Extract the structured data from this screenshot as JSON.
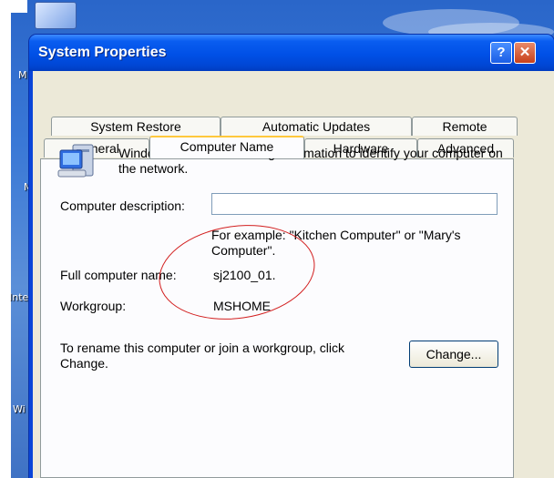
{
  "desktop": {
    "labels": [
      "M",
      "M",
      "Inte",
      "Wi"
    ]
  },
  "window": {
    "title": "System Properties",
    "help_btn": "?",
    "close_btn": "✕"
  },
  "tabs": {
    "row1": [
      "System Restore",
      "Automatic Updates",
      "Remote"
    ],
    "row2": [
      "General",
      "Computer Name",
      "Hardware",
      "Advanced"
    ],
    "active": "Computer Name"
  },
  "computer_name_tab": {
    "intro": "Windows uses the following information to identify your computer on the network.",
    "description_label": "Computer description:",
    "description_value": "",
    "example_text": "For example: \"Kitchen Computer\" or \"Mary's Computer\".",
    "full_name_label": "Full computer name:",
    "full_name_value": "sj2100_01.",
    "workgroup_label": "Workgroup:",
    "workgroup_value": "MSHOME",
    "rename_text": "To rename this computer or join a workgroup, click Change.",
    "change_button": "Change..."
  },
  "colors": {
    "titlebar": "#0050e6",
    "dialog_bg": "#ece9d8",
    "panel_bg": "#fcfcfe",
    "annotation_oval": "#d21e1e",
    "active_tab_accent": "#ffc83c"
  }
}
